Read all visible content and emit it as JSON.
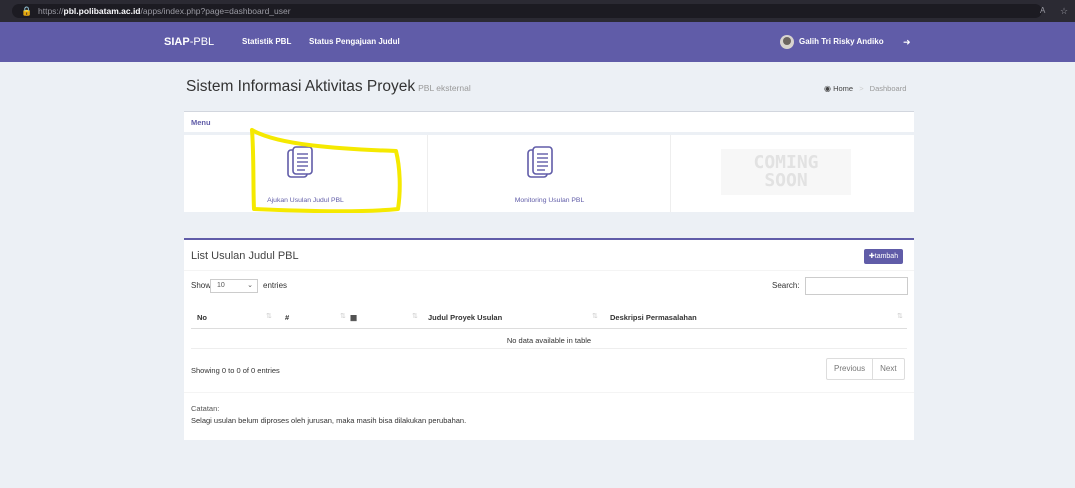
{
  "browser": {
    "url_prefix": "https://",
    "url_domain": "pbl.polibatam.ac.id",
    "url_path": "/apps/index.php?page=dashboard_user"
  },
  "navbar": {
    "brand_bold": "SIAP",
    "brand_rest": "-PBL",
    "links": [
      "Statistik PBL",
      "Status Pengajuan Judul"
    ],
    "user": "Galih Tri Risky Andiko",
    "color": "#605ca8"
  },
  "header": {
    "title": "Sistem Informasi Aktivitas Proyek",
    "subtitle": "PBL eksternal",
    "breadcrumb_home": "Home",
    "breadcrumb_current": "Dashboard"
  },
  "menu": {
    "heading": "Menu",
    "tiles": [
      {
        "label": "Ajukan Usulan Judul PBL",
        "icon": "document-icon"
      },
      {
        "label": "Monitoring Usulan PBL",
        "icon": "document-icon"
      },
      {
        "label": "",
        "icon": "coming-soon-image",
        "image_text_line1": "COMING",
        "image_text_line2": "SOON"
      }
    ]
  },
  "list": {
    "title": "List Usulan Judul PBL",
    "add_button": "tambah",
    "show_label": "Show",
    "entries_value": "10",
    "entries_label": "entries",
    "search_label": "Search:",
    "columns": [
      "No",
      "#",
      "",
      "Judul Proyek Usulan",
      "Deskripsi Permasalahan"
    ],
    "empty_message": "No data available in table",
    "info": "Showing 0 to 0 of 0 entries",
    "prev": "Previous",
    "next": "Next",
    "note_label": "Catatan:",
    "note_text": "Selagi usulan belum diproses oleh jurusan, maka masih bisa dilakukan perubahan."
  },
  "annotation": {
    "highlight_color": "#f5e900"
  }
}
